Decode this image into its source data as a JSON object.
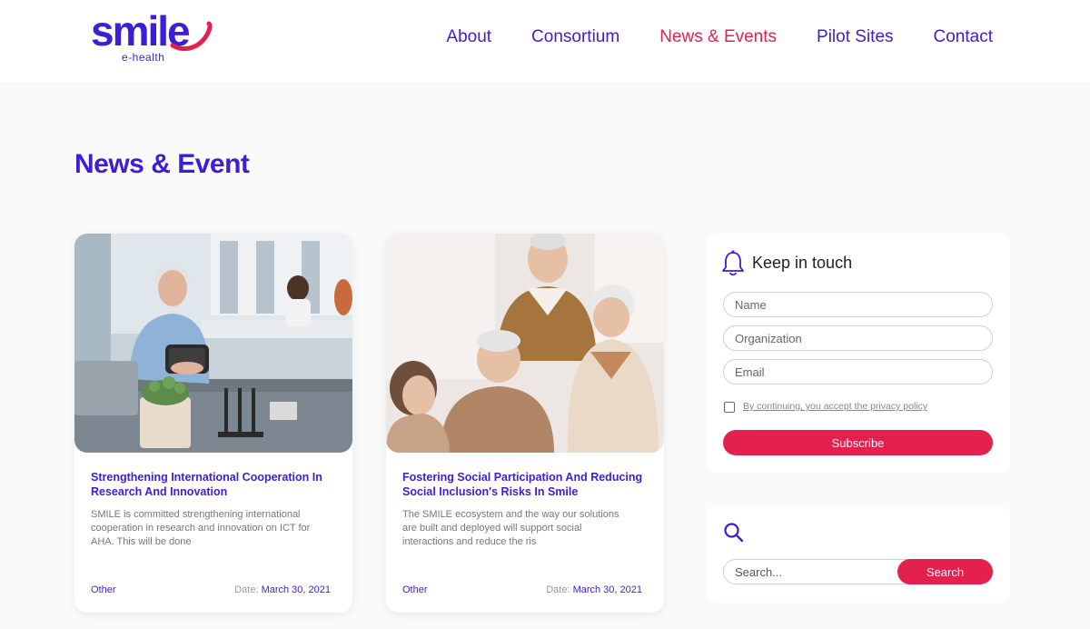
{
  "brand": {
    "logo_text": "smile",
    "logo_sub": "e-health",
    "primary_color": "#3b1ed6",
    "accent_color": "#e4204f"
  },
  "nav": {
    "items": [
      {
        "label": "About",
        "active": false
      },
      {
        "label": "Consortium",
        "active": false
      },
      {
        "label": "News & Events",
        "active": true
      },
      {
        "label": "Pilot Sites",
        "active": false
      },
      {
        "label": "Contact",
        "active": false
      }
    ]
  },
  "page": {
    "title": "News & Event"
  },
  "cards": [
    {
      "title": "Strengthening International Cooperation In Research And Innovation",
      "excerpt": "SMILE is committed strengthening international cooperation in research and innovation on ICT for AHA. This will be done",
      "category": "Other",
      "date_label": "Date:",
      "date_value": "March 30, 2021",
      "image_icon": "photo-woman-vr-headset"
    },
    {
      "title": "Fostering Social Participation And Reducing Social Inclusion's Risks In Smile",
      "excerpt": "The SMILE ecosystem and the way our solutions are built and deployed will support social interactions and reduce the ris",
      "category": "Other",
      "date_label": "Date:",
      "date_value": "March 30, 2021",
      "image_icon": "photo-seniors-laughing"
    }
  ],
  "subscribe": {
    "title": "Keep in touch",
    "icon": "bell-icon",
    "name_placeholder": "Name",
    "organization_placeholder": "Organization",
    "email_placeholder": "Email",
    "consent_text": "By continuing, you accept the privacy policy",
    "button_label": "Subscribe"
  },
  "search": {
    "icon": "search-icon",
    "placeholder": "Search...",
    "button_label": "Search"
  }
}
